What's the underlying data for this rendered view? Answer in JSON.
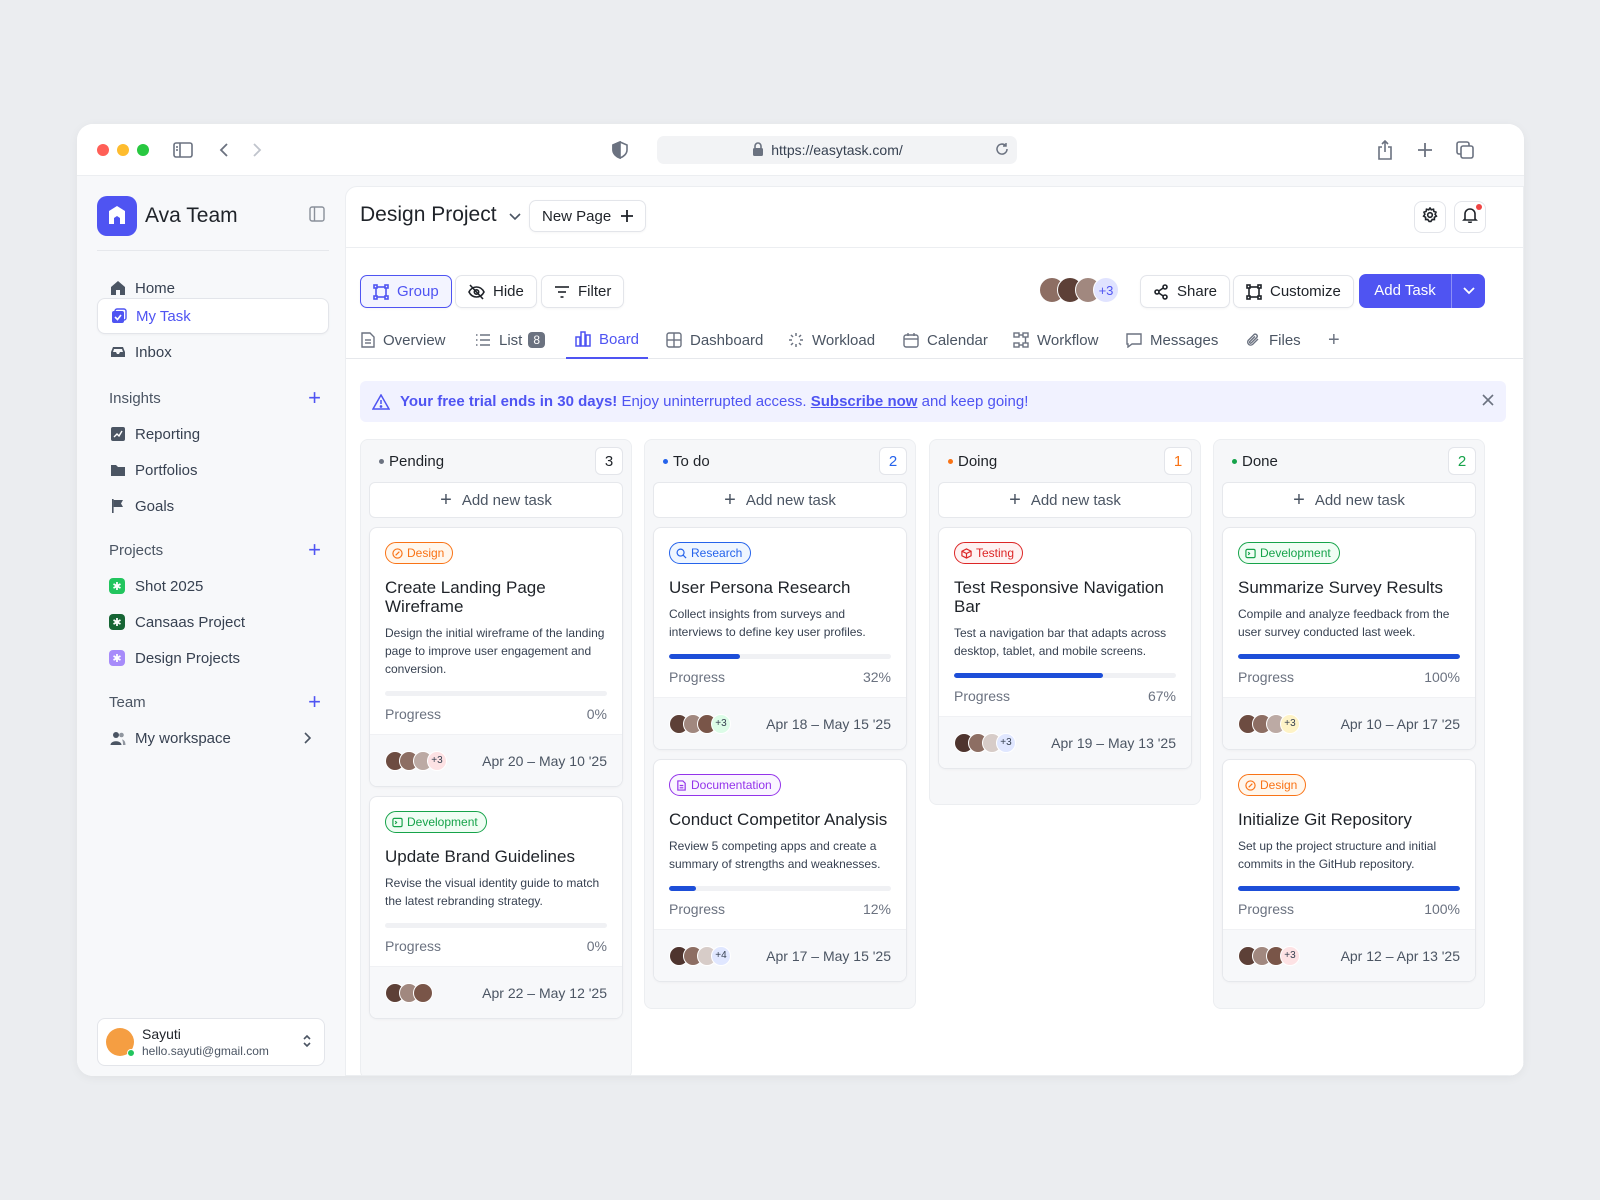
{
  "browser": {
    "url": "https://easytask.com/"
  },
  "sidebar": {
    "team_name": "Ava Team",
    "nav": [
      {
        "label": "Home"
      },
      {
        "label": "My Task"
      },
      {
        "label": "Inbox"
      }
    ],
    "insights": {
      "label": "Insights",
      "items": [
        {
          "label": "Reporting"
        },
        {
          "label": "Portfolios"
        },
        {
          "label": "Goals"
        }
      ]
    },
    "projects": {
      "label": "Projects",
      "items": [
        {
          "label": "Shot 2025",
          "color": "#22c55e"
        },
        {
          "label": "Cansaas Project",
          "color": "#166534"
        },
        {
          "label": "Design Projects",
          "color": "#8b5cf6"
        }
      ]
    },
    "team": {
      "label": "Team",
      "items": [
        {
          "label": "My workspace"
        }
      ]
    },
    "user": {
      "name": "Sayuti",
      "email": "hello.sayuti@gmail.com"
    }
  },
  "header": {
    "title": "Design Project",
    "new_page": "New Page"
  },
  "toolbar": {
    "group": "Group",
    "hide": "Hide",
    "filter": "Filter",
    "members_more": "+3",
    "share": "Share",
    "customize": "Customize",
    "add_task": "Add Task"
  },
  "tabs": [
    {
      "label": "Overview",
      "icon": "document-icon"
    },
    {
      "label": "List",
      "icon": "list-icon",
      "badge": "8"
    },
    {
      "label": "Board",
      "icon": "board-icon"
    },
    {
      "label": "Dashboard",
      "icon": "grid-icon"
    },
    {
      "label": "Workload",
      "icon": "loader-icon"
    },
    {
      "label": "Calendar",
      "icon": "calendar-icon"
    },
    {
      "label": "Workflow",
      "icon": "workflow-icon"
    },
    {
      "label": "Messages",
      "icon": "message-icon"
    },
    {
      "label": "Files",
      "icon": "paperclip-icon"
    }
  ],
  "banner": {
    "bold": "Your free trial ends in 30 days!",
    "text1": " Enjoy uninterrupted access. ",
    "link": "Subscribe now",
    "text2": " and keep going!"
  },
  "board": {
    "add_label": "Add new task",
    "progress_label": "Progress",
    "columns": [
      {
        "name": "Pending",
        "count": "3",
        "dot": "#6b7280",
        "count_color": "#1f2329",
        "cards": [
          {
            "tag": "Design",
            "tag_color": "#f97316",
            "title": "Create Landing Page Wireframe",
            "desc": "Design the initial wireframe of the landing page to improve user engagement and conversion.",
            "progress": 0,
            "progress_text": "0%",
            "more": "+3",
            "dates": "Apr 20 – May 10 '25"
          },
          {
            "tag": "Development",
            "tag_color": "#16a34a",
            "title": "Update Brand Guidelines",
            "desc": "Revise the visual identity guide to match the latest rebranding strategy.",
            "progress": 0,
            "progress_text": "0%",
            "more": "",
            "dates": "Apr 22 – May 12 '25"
          }
        ]
      },
      {
        "name": "To do",
        "count": "2",
        "dot": "#2563eb",
        "count_color": "#2563eb",
        "cards": [
          {
            "tag": "Research",
            "tag_color": "#2563eb",
            "title": "User Persona Research",
            "desc": "Collect insights from surveys and interviews to define key user profiles.",
            "progress": 32,
            "progress_text": "32%",
            "more": "+3",
            "dates": "Apr 18 – May 15 '25"
          },
          {
            "tag": "Documentation",
            "tag_color": "#9333ea",
            "title": "Conduct Competitor Analysis",
            "desc": "Review 5 competing apps and create a summary of strengths and weaknesses.",
            "progress": 12,
            "progress_text": "12%",
            "more": "+4",
            "dates": "Apr 17 – May 15 '25"
          }
        ]
      },
      {
        "name": "Doing",
        "count": "1",
        "dot": "#f97316",
        "count_color": "#f97316",
        "cards": [
          {
            "tag": "Testing",
            "tag_color": "#dc2626",
            "title": "Test Responsive Navigation Bar",
            "desc": "Test a navigation bar that adapts across desktop, tablet, and mobile screens.",
            "progress": 67,
            "progress_text": "67%",
            "more": "+3",
            "dates": "Apr 19 – May 13 '25"
          }
        ]
      },
      {
        "name": "Done",
        "count": "2",
        "dot": "#16a34a",
        "count_color": "#16a34a",
        "cards": [
          {
            "tag": "Development",
            "tag_color": "#16a34a",
            "title": "Summarize Survey Results",
            "desc": "Compile and analyze feedback from the user survey conducted last week.",
            "progress": 100,
            "progress_text": "100%",
            "more": "+3",
            "dates": "Apr 10 – Apr 17 '25"
          },
          {
            "tag": "Design",
            "tag_color": "#f97316",
            "title": "Initialize Git Repository",
            "desc": "Set up the project structure and initial commits in the GitHub repository.",
            "progress": 100,
            "progress_text": "100%",
            "more": "+3",
            "dates": "Apr 12 – Apr 13 '25"
          }
        ]
      }
    ]
  }
}
